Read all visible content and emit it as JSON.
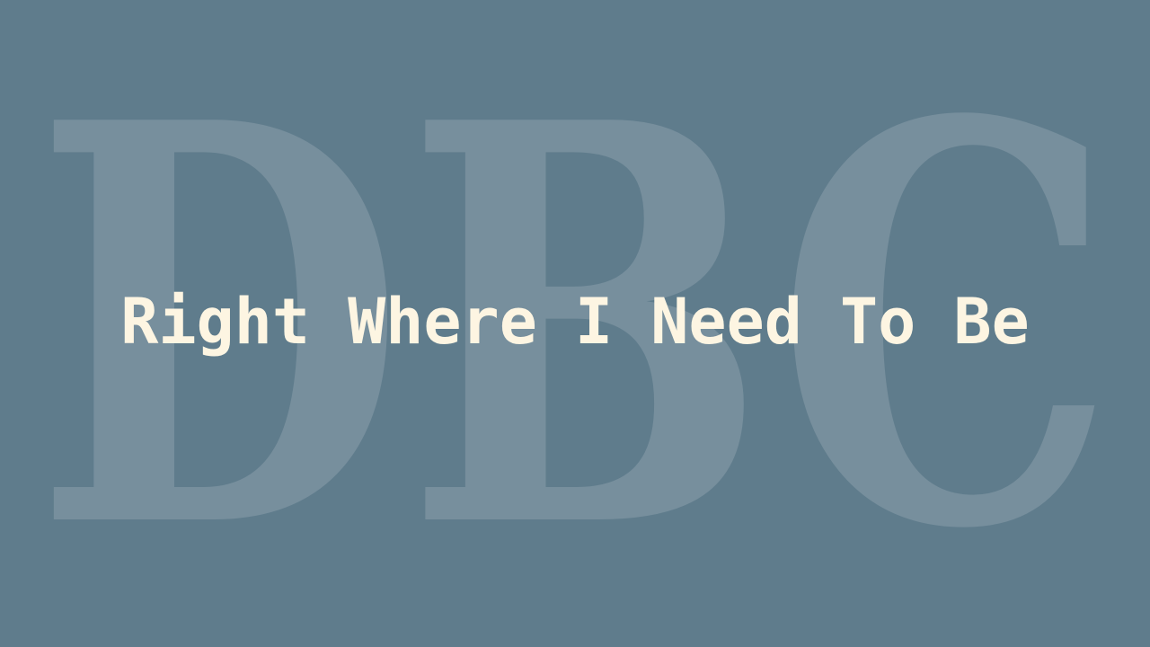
{
  "watermark": {
    "text": "DBC"
  },
  "headline": {
    "text": "Right Where I Need To Be"
  },
  "colors": {
    "background": "#5f7c8c",
    "watermark": "#778f9d",
    "headline": "#fdf5e2"
  }
}
